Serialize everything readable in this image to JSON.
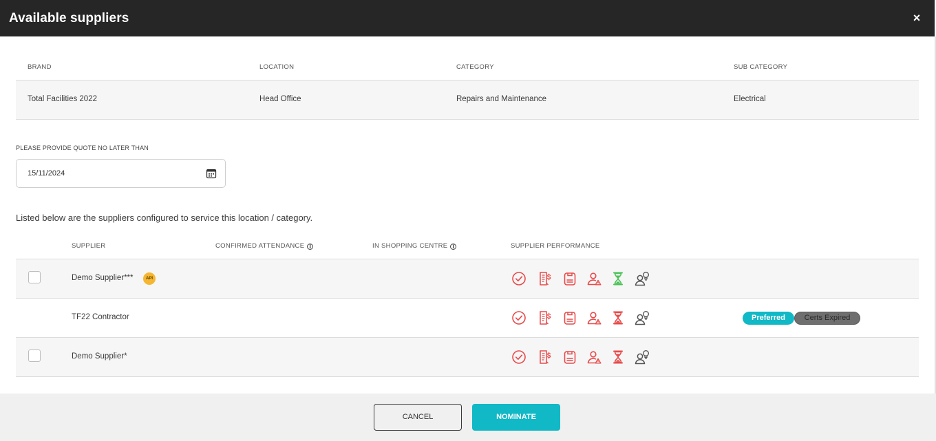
{
  "modal": {
    "title": "Available suppliers",
    "close_glyph": "×"
  },
  "info": {
    "headers": {
      "brand": "BRAND",
      "location": "LOCATION",
      "category": "CATEGORY",
      "sub_category": "SUB CATEGORY"
    },
    "row": {
      "brand": "Total Facilities 2022",
      "location": "Head Office",
      "category": "Repairs and Maintenance",
      "sub_category": "Electrical"
    }
  },
  "quote": {
    "label": "PLEASE PROVIDE QUOTE NO LATER THAN",
    "date": "15/11/2024",
    "icon": "calendar-icon"
  },
  "listing_text": "Listed below are the suppliers configured to service this location / category.",
  "suppliers": {
    "headers": {
      "supplier": "SUPPLIER",
      "confirmed_attendance": "CONFIRMED ATTENDANCE",
      "in_shopping_centre": "IN SHOPPING CENTRE",
      "performance": "SUPPLIER PERFORMANCE"
    },
    "info_glyph": "i",
    "rows": [
      {
        "name": "Demo Supplier***",
        "has_checkbox": true,
        "api_badge": "API",
        "hourglass_color": "#4cc35a",
        "tags": []
      },
      {
        "name": "TF22 Contractor",
        "has_checkbox": false,
        "api_badge": "",
        "hourglass_color": "#e84a4a",
        "tags": [
          "Preferred",
          "Certs Expired"
        ]
      },
      {
        "name": "Demo Supplier*",
        "has_checkbox": true,
        "api_badge": "",
        "hourglass_color": "#e84a4a",
        "tags": []
      }
    ],
    "performance_icons": [
      "check-circle-icon",
      "invoice-dollar-icon",
      "clipboard-icon",
      "person-alert-icon",
      "hourglass-icon",
      "person-lightbulb-icon"
    ]
  },
  "colors": {
    "header_bg": "#262626",
    "accent": "#11b8c6",
    "icon_red": "#e84a4a",
    "icon_grey": "#555555",
    "api_badge": "#f5b731"
  },
  "footer": {
    "cancel_label": "CANCEL",
    "nominate_label": "NOMINATE"
  }
}
